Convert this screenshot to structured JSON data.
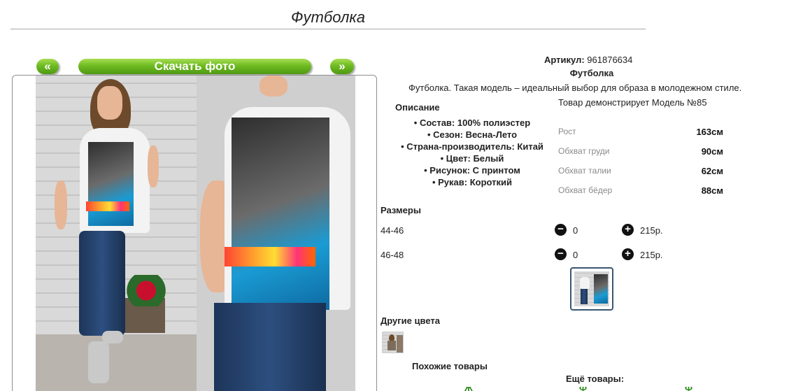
{
  "page": {
    "title": "Футболка"
  },
  "gallery": {
    "prev_label": "«",
    "download_label": "Скачать фото",
    "next_label": "»"
  },
  "product": {
    "sku_label": "Артикул:",
    "sku_value": "961876634",
    "name": "Футболка",
    "description": "Футболка. Такая модель – идеальный выбор для образа в молодежном стиле."
  },
  "specs": {
    "heading": "Описание",
    "items": [
      "Состав: 100% полиэстер",
      "Сезон: Весна-Лето",
      "Страна-производитель: Китай",
      "Цвет: Белый",
      "Рисунок: С принтом",
      "Рукав: Короткий"
    ]
  },
  "model": {
    "caption": "Товар демонстрирует Модель №85",
    "measurements": [
      {
        "label": "Рост",
        "value": "163см"
      },
      {
        "label": "Обхват груди",
        "value": "90см"
      },
      {
        "label": "Обхват талии",
        "value": "62см"
      },
      {
        "label": "Обхват бёдер",
        "value": "88см"
      }
    ]
  },
  "sizes": {
    "heading": "Размеры",
    "rows": [
      {
        "size": "44-46",
        "qty": "0",
        "price": "215р."
      },
      {
        "size": "46-48",
        "qty": "0",
        "price": "215р."
      }
    ],
    "minus_glyph": "−",
    "plus_glyph": "+"
  },
  "other_colors": {
    "heading": "Другие цвета"
  },
  "similar": {
    "heading": "Похожие товары"
  },
  "more": {
    "heading": "Ещё товары:"
  },
  "colors": {
    "button_green": "#6fbb22",
    "thumb_border": "#3a5673",
    "link_green": "#2e8b1e"
  },
  "icons": {
    "minus": "minus-circle-icon",
    "plus": "plus-circle-icon"
  }
}
